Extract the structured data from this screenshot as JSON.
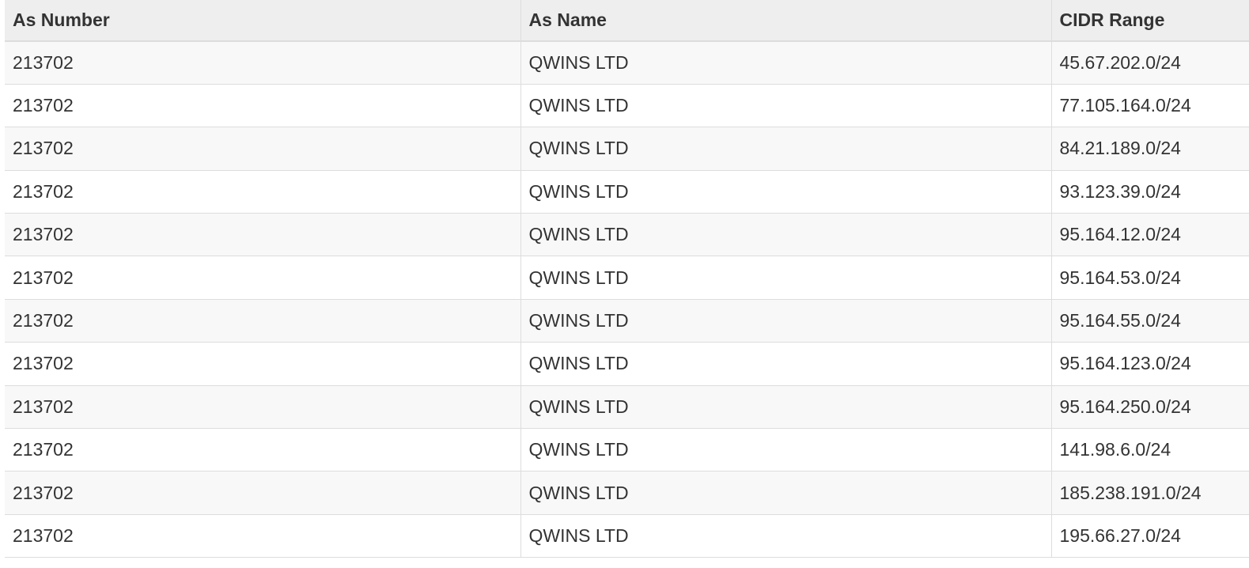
{
  "table": {
    "headers": [
      "As Number",
      "As Name",
      "CIDR Range"
    ],
    "rows": [
      [
        "213702",
        "QWINS LTD",
        "45.67.202.0/24"
      ],
      [
        "213702",
        "QWINS LTD",
        "77.105.164.0/24"
      ],
      [
        "213702",
        "QWINS LTD",
        "84.21.189.0/24"
      ],
      [
        "213702",
        "QWINS LTD",
        "93.123.39.0/24"
      ],
      [
        "213702",
        "QWINS LTD",
        "95.164.12.0/24"
      ],
      [
        "213702",
        "QWINS LTD",
        "95.164.53.0/24"
      ],
      [
        "213702",
        "QWINS LTD",
        "95.164.55.0/24"
      ],
      [
        "213702",
        "QWINS LTD",
        "95.164.123.0/24"
      ],
      [
        "213702",
        "QWINS LTD",
        "95.164.250.0/24"
      ],
      [
        "213702",
        "QWINS LTD",
        "141.98.6.0/24"
      ],
      [
        "213702",
        "QWINS LTD",
        "185.238.191.0/24"
      ],
      [
        "213702",
        "QWINS LTD",
        "195.66.27.0/24"
      ]
    ]
  }
}
